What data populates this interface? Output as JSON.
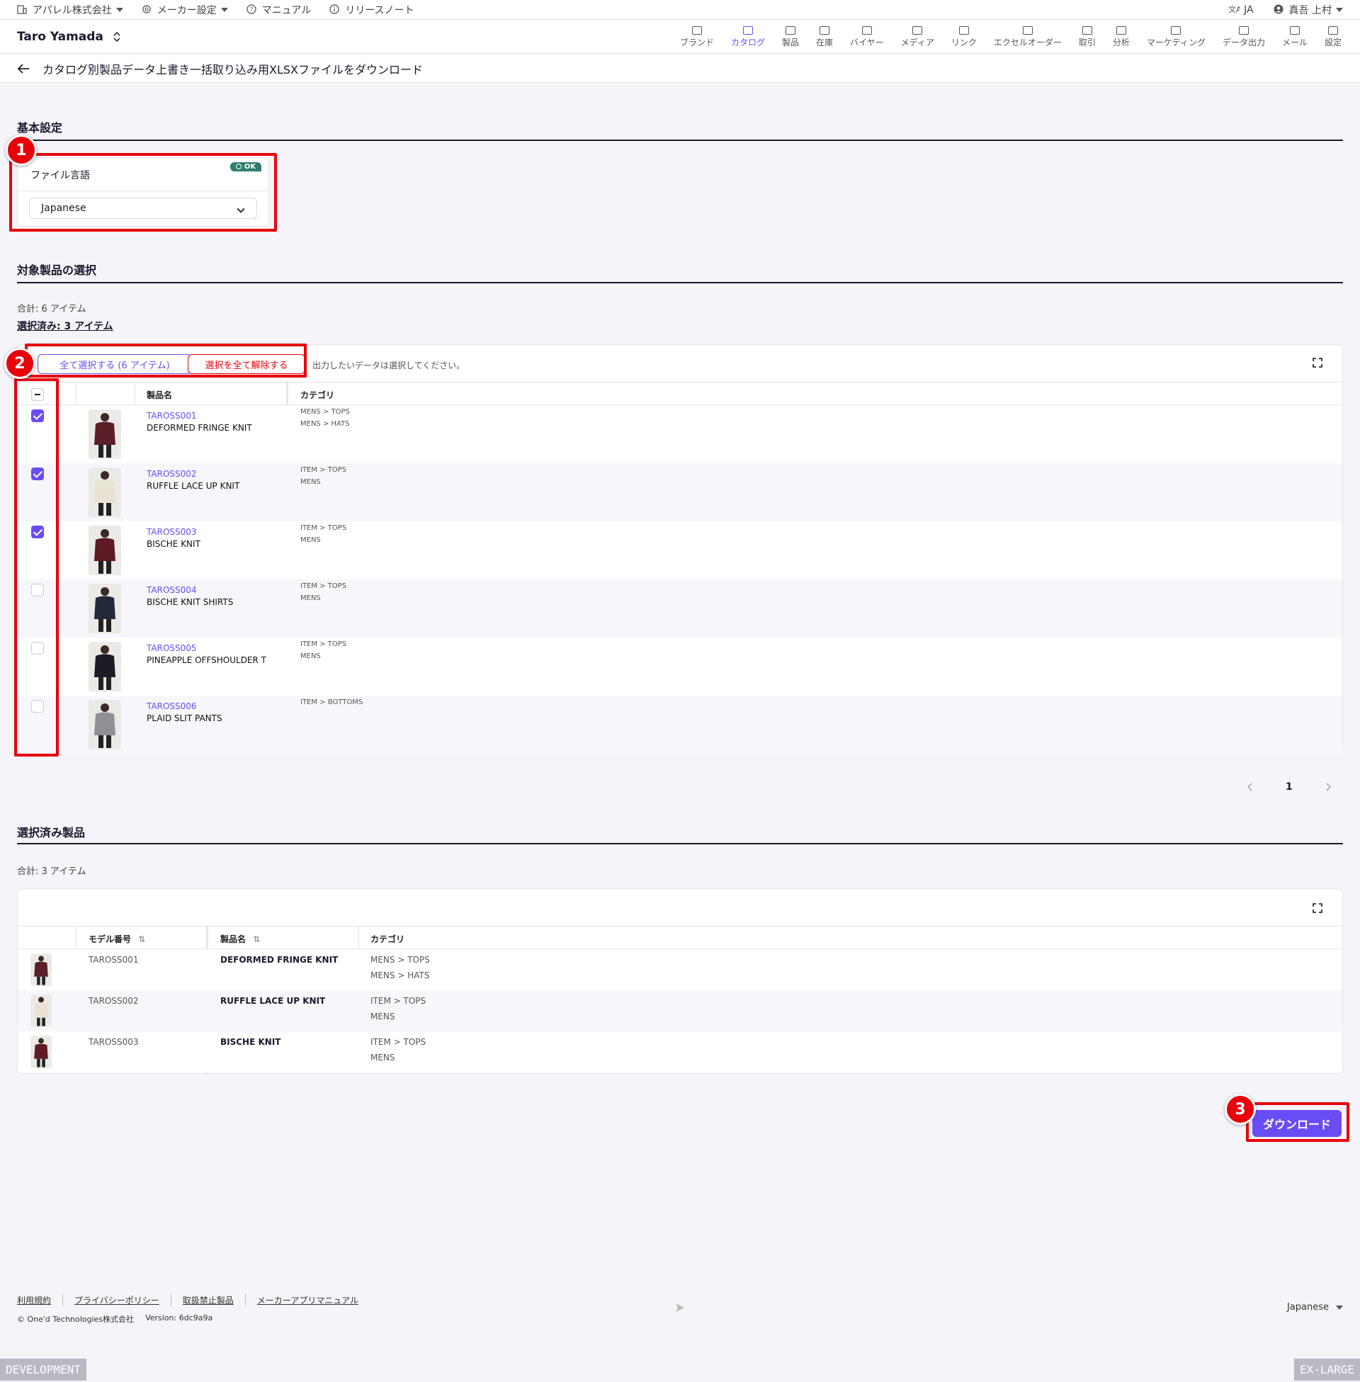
{
  "topbar": {
    "company": "アパレル株式会社",
    "maker_settings": "メーカー設定",
    "manual": "マニュアル",
    "release_notes": "リリースノート",
    "language": "JA",
    "user": "真吾 上村"
  },
  "navbar": {
    "brand": "Taro Yamada",
    "items": [
      "ブランド",
      "カタログ",
      "製品",
      "在庫",
      "バイヤー",
      "メディア",
      "リンク",
      "エクセルオーダー",
      "取引",
      "分析",
      "マーケティング",
      "データ出力",
      "メール",
      "設定"
    ],
    "active": "カタログ"
  },
  "page": {
    "title": "カタログ別製品データ上書き一括取り込み用XLSXファイルをダウンロード"
  },
  "basic_settings": {
    "title": "基本設定",
    "file_language_label": "ファイル言語",
    "ok_badge": "OK",
    "language_value": "Japanese"
  },
  "product_selection": {
    "title": "対象製品の選択",
    "total": "合計: 6 アイテム",
    "selected": "選択済み: 3 アイテム",
    "select_all": "全て選択する (6 アイテム)",
    "deselect_all": "選択を全て解除する",
    "hint": "出力したいデータは選択してください。",
    "headers": {
      "name": "製品名",
      "category": "カテゴリ"
    },
    "rows": [
      {
        "code": "TAROSS001",
        "name": "DEFORMED FRINGE KNIT",
        "cat1": "MENS > TOPS",
        "cat2": "MENS > HATS",
        "checked": true,
        "color": "#5a1f28"
      },
      {
        "code": "TAROSS002",
        "name": "RUFFLE LACE UP KNIT",
        "cat1": "ITEM > TOPS",
        "cat2": "MENS",
        "checked": true,
        "color": "#e8e2d4"
      },
      {
        "code": "TAROSS003",
        "name": "BISCHE KNIT",
        "cat1": "ITEM > TOPS",
        "cat2": "MENS",
        "checked": true,
        "color": "#5e1b24"
      },
      {
        "code": "TAROSS004",
        "name": "BISCHE KNIT SHIRTS",
        "cat1": "ITEM > TOPS",
        "cat2": "MENS",
        "checked": false,
        "color": "#23283a"
      },
      {
        "code": "TAROSS005",
        "name": "PINEAPPLE OFFSHOULDER T",
        "cat1": "ITEM > TOPS",
        "cat2": "MENS",
        "checked": false,
        "color": "#1c1c24"
      },
      {
        "code": "TAROSS006",
        "name": "PLAID SLIT PANTS",
        "cat1": "ITEM > BOTTOMS",
        "cat2": "",
        "checked": false,
        "color": "#8f8f96"
      }
    ],
    "page_number": "1"
  },
  "selected_products": {
    "title": "選択済み製品",
    "total": "合計: 3 アイテム",
    "headers": {
      "model": "モデル番号",
      "name": "製品名",
      "category": "カテゴリ"
    },
    "rows": [
      {
        "code": "TAROSS001",
        "name": "DEFORMED FRINGE KNIT",
        "cat1": "MENS > TOPS",
        "cat2": "MENS > HATS",
        "color": "#5a1f28"
      },
      {
        "code": "TAROSS002",
        "name": "RUFFLE LACE UP KNIT",
        "cat1": "ITEM > TOPS",
        "cat2": "MENS",
        "color": "#e8e2d4"
      },
      {
        "code": "TAROSS003",
        "name": "BISCHE KNIT",
        "cat1": "ITEM > TOPS",
        "cat2": "MENS",
        "color": "#5e1b24"
      }
    ]
  },
  "actions": {
    "download": "ダウンロード"
  },
  "markers": [
    "1",
    "2",
    "3"
  ],
  "footer": {
    "links": [
      "利用規約",
      "プライバシーポリシー",
      "取扱禁止製品",
      "メーカーアプリマニュアル"
    ],
    "copyright": "© One'd Technologies株式会社",
    "version": "Version: 6dc9a9a",
    "language": "Japanese"
  },
  "env": {
    "left": "DEVELOPMENT",
    "right": "EX-LARGE"
  },
  "colors": {
    "accent": "#6a4cf5",
    "highlight": "#e8000b",
    "ok": "#2f7d6d"
  }
}
